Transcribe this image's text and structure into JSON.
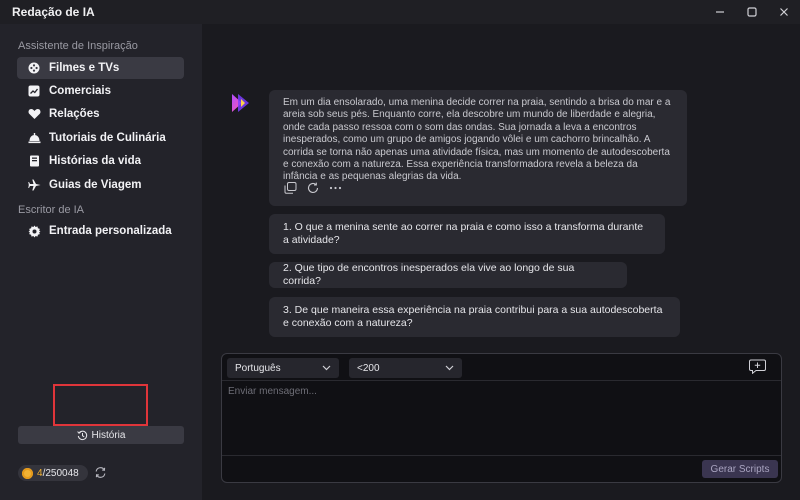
{
  "app": {
    "title": "Redação de IA"
  },
  "sidebar": {
    "section_inspiration": "Assistente de Inspiração",
    "section_writer": "Escritor de IA",
    "items": [
      {
        "label": "Filmes e TVs",
        "icon": "film-icon",
        "active": true
      },
      {
        "label": "Comerciais",
        "icon": "chart-icon",
        "active": false
      },
      {
        "label": "Relações",
        "icon": "heart-handshake-icon",
        "active": false
      },
      {
        "label": "Tutoriais de Culinária",
        "icon": "chef-icon",
        "active": false
      },
      {
        "label": "Histórias da vida",
        "icon": "book-icon",
        "active": false
      },
      {
        "label": "Guias de Viagem",
        "icon": "airplane-icon",
        "active": false
      }
    ],
    "custom_item": {
      "label": "Entrada personalizada",
      "icon": "gear-icon"
    },
    "history_button": "História",
    "credits": {
      "used": "4",
      "total": "/250048"
    }
  },
  "chat": {
    "response_text": "Em um dia ensolarado, uma menina decide correr na praia, sentindo a brisa do mar e a areia sob seus pés. Enquanto corre, ela descobre um mundo de liberdade e alegria, onde cada passo ressoa com o som das ondas. Sua jornada a leva a encontros inesperados, como um grupo de amigos jogando vôlei e um cachorro brincalhão. A corrida se torna não apenas uma atividade física, mas um momento de autodescoberta e conexão com a natureza. Essa experiência transformadora revela a beleza da infância e as pequenas alegrias da vida.",
    "questions": [
      "1. O que a menina sente ao correr na praia e como isso a transforma durante a atividade?",
      "2. Que tipo de encontros inesperados ela vive ao longo de sua corrida?",
      "3. De que maneira essa experiência na praia contribui para a sua autodescoberta e conexão com a natureza?"
    ]
  },
  "composer": {
    "language": "Português",
    "length": "<200",
    "placeholder": "Enviar mensagem...",
    "generate_button": "Gerar Scripts"
  },
  "colors": {
    "accent": "#8a3ffc",
    "highlight": "#e0353a",
    "coin": "#f2b234"
  }
}
